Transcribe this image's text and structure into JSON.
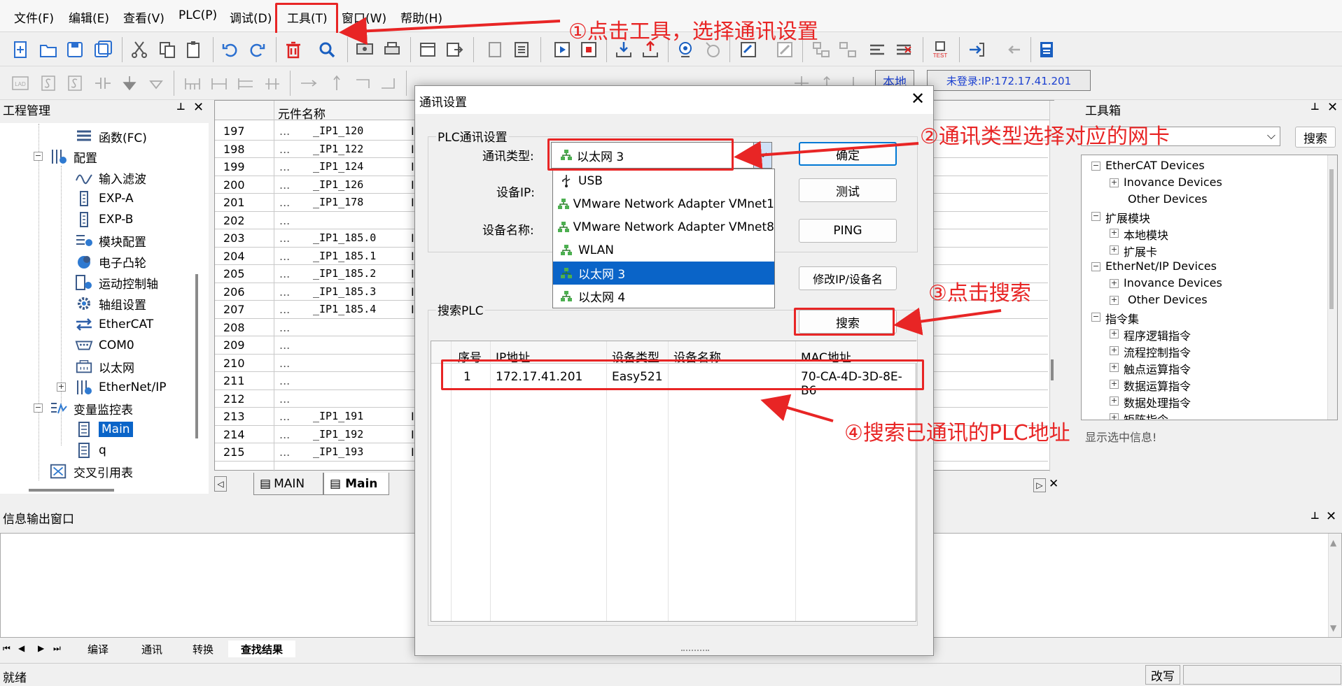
{
  "menu": [
    "文件(F)",
    "编辑(E)",
    "查看(V)",
    "PLC(P)",
    "调试(D)",
    "工具(T)",
    "窗口(W)",
    "帮助(H)"
  ],
  "status_bar": {
    "local_label": "本地",
    "login": "未登录:IP:172.17.41.201",
    "ready": "就绪",
    "mode": "改写"
  },
  "toolbar2_text": {
    "lad": "LAD"
  },
  "project_panel": {
    "title": "工程管理",
    "items": [
      "函数(FC)",
      "配置",
      "输入滤波",
      "EXP-A",
      "EXP-B",
      "模块配置",
      "电子凸轮",
      "运动控制轴",
      "轴组设置",
      "EtherCAT",
      "COM0",
      "以太网",
      "EtherNet/IP",
      "变量监控表",
      "Main",
      "q",
      "交叉引用表"
    ]
  },
  "grid": {
    "header": "元件名称",
    "rows": [
      {
        "n": "197",
        "name": "_IP1_120",
        "t": "I"
      },
      {
        "n": "198",
        "name": "_IP1_122",
        "t": "I"
      },
      {
        "n": "199",
        "name": "_IP1_124",
        "t": "I"
      },
      {
        "n": "200",
        "name": "_IP1_126",
        "t": "I"
      },
      {
        "n": "201",
        "name": "_IP1_178",
        "t": "I"
      },
      {
        "n": "202",
        "name": "",
        "t": ""
      },
      {
        "n": "203",
        "name": "_IP1_185.0",
        "t": "I"
      },
      {
        "n": "204",
        "name": "_IP1_185.1",
        "t": "I"
      },
      {
        "n": "205",
        "name": "_IP1_185.2",
        "t": "I"
      },
      {
        "n": "206",
        "name": "_IP1_185.3",
        "t": "I"
      },
      {
        "n": "207",
        "name": "_IP1_185.4",
        "t": "I"
      },
      {
        "n": "208",
        "name": "",
        "t": ""
      },
      {
        "n": "209",
        "name": "",
        "t": ""
      },
      {
        "n": "210",
        "name": "",
        "t": ""
      },
      {
        "n": "211",
        "name": "",
        "t": ""
      },
      {
        "n": "212",
        "name": "",
        "t": ""
      },
      {
        "n": "213",
        "name": "_IP1_191",
        "t": "I"
      },
      {
        "n": "214",
        "name": "_IP1_192",
        "t": "I"
      },
      {
        "n": "215",
        "name": "_IP1_193",
        "t": "I"
      }
    ],
    "dots": "...",
    "tabs": [
      "MAIN",
      "Main"
    ]
  },
  "toolbox": {
    "title": "工具箱",
    "search_button": "搜索",
    "items": [
      "EtherCAT Devices",
      "Inovance Devices",
      "Other Devices",
      "扩展模块",
      "本地模块",
      "扩展卡",
      "EtherNet/IP Devices",
      "Inovance Devices",
      "Other Devices",
      "指令集",
      "程序逻辑指令",
      "流程控制指令",
      "触点运算指令",
      "数据运算指令",
      "数据处理指令",
      "矩阵指令"
    ],
    "info": "显示选中信息!"
  },
  "output_panel": {
    "title": "信息输出窗口",
    "tabs": [
      "编译",
      "通讯",
      "转换",
      "查找结果"
    ]
  },
  "dialog": {
    "title": "通讯设置",
    "group_plc": "PLC通讯设置",
    "comm_type_label": "通讯类型:",
    "comm_type_value": "以太网 3",
    "device_ip_label": "设备IP:",
    "device_name_label": "设备名称:",
    "dropdown": [
      "USB",
      "VMware Network Adapter VMnet1",
      "VMware Network Adapter VMnet8",
      "WLAN",
      "以太网 3",
      "以太网 4"
    ],
    "selected_index": 4,
    "buttons": {
      "ok": "确定",
      "test": "测试",
      "ping": "PING",
      "modify": "修改IP/设备名",
      "search": "搜索"
    },
    "search_group": "搜索PLC",
    "columns": [
      "序号",
      "IP地址",
      "设备类型",
      "设备名称",
      "MAC地址"
    ],
    "rows": [
      {
        "no": "1",
        "ip": "172.17.41.201",
        "type": "Easy521",
        "name": "",
        "mac": "70-CA-4D-3D-8E-B6"
      }
    ]
  },
  "annotations": [
    "①点击工具，选择通讯设置",
    "②通讯类型选择对应的网卡",
    "③点击搜索",
    "④搜索已通讯的PLC地址"
  ],
  "colors": {
    "annotation": "#e82525",
    "selection": "#0a64c8"
  }
}
